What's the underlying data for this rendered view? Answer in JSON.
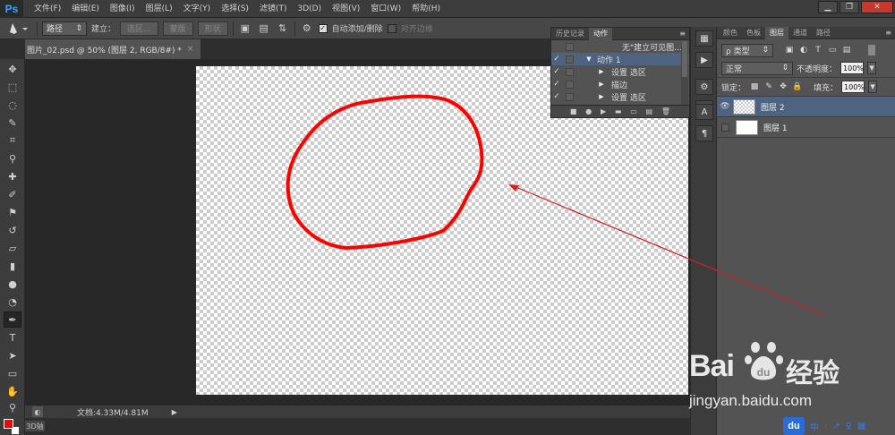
{
  "app": {
    "logo": "Ps"
  },
  "menu": [
    "文件(F)",
    "编辑(E)",
    "图像(I)",
    "图层(L)",
    "文字(Y)",
    "选择(S)",
    "滤镜(T)",
    "3D(D)",
    "视图(V)",
    "窗口(W)",
    "帮助(H)"
  ],
  "window_controls": {
    "minimize": "▁",
    "restore": "❐",
    "close": "✕"
  },
  "options_bar": {
    "mode_value": "路径",
    "make_label": "建立：",
    "selection_btn": "选区...",
    "mask_btn": "蒙版",
    "shape_btn": "形状",
    "auto_add_delete_label": "自动添加/删除",
    "align_edges_label": "对齐边缘"
  },
  "document_tab": {
    "title": "图片_02.psd @ 50% (图层 2, RGB/8#) *",
    "close": "×"
  },
  "status_bar": {
    "doc_info": "文档:4.33M/4.81M",
    "zoom_icon": "◐",
    "arrow": "▶"
  },
  "bottom_tab": "3D轴",
  "actions_panel": {
    "tabs": [
      "历史记录",
      "动作"
    ],
    "active_tab": 1,
    "menu_icon": "≡",
    "rows": [
      {
        "check": "",
        "tri": "",
        "text": "无\"建立可见图..."
      },
      {
        "check": "✓",
        "tri": "▼",
        "text": "动作 1",
        "selected": true
      },
      {
        "check": "✓",
        "tri": "▶",
        "text": "设置 选区"
      },
      {
        "check": "✓",
        "tri": "▶",
        "text": "描边"
      },
      {
        "check": "✓",
        "tri": "▶",
        "text": "设置 选区"
      }
    ],
    "footer_icons": [
      "■",
      "●",
      "▶",
      "▬",
      "▭",
      "▤",
      "🗑"
    ]
  },
  "icon_strip": {
    "buttons": [
      "▦",
      "▶",
      "⚙",
      "◧",
      "A",
      "¶"
    ]
  },
  "layers_panel": {
    "tabs": [
      "颜色",
      "色板",
      "图层",
      "通道",
      "路径"
    ],
    "active_tab": 2,
    "menu_icon": "≡",
    "kind_filter": "ρ 类型",
    "filter_icons": [
      "▣",
      "◐",
      "T",
      "▭",
      "▤"
    ],
    "blend_mode": "正常",
    "opacity_label": "不透明度：",
    "opacity_value": "100%",
    "lock_label": "锁定：",
    "lock_icons": [
      "▩",
      "✎",
      "✥",
      "🔒"
    ],
    "fill_label": "填充：",
    "fill_value": "100%",
    "layers": [
      {
        "name": "图层 2",
        "visible": true,
        "selected": true,
        "thumb": "transparent"
      },
      {
        "name": "图层 1",
        "visible": false,
        "selected": false,
        "thumb": "white"
      }
    ]
  },
  "watermark": {
    "brand": "Bai",
    "brand_suffix": "经验",
    "url": "jingyan.baidu.com",
    "du_logo": "du",
    "du_items": [
      "中",
      "·",
      "↗",
      "♀",
      "▦"
    ]
  },
  "annotation": {
    "stroke_color": "#ff0000",
    "arrow_color": "#d42020"
  }
}
